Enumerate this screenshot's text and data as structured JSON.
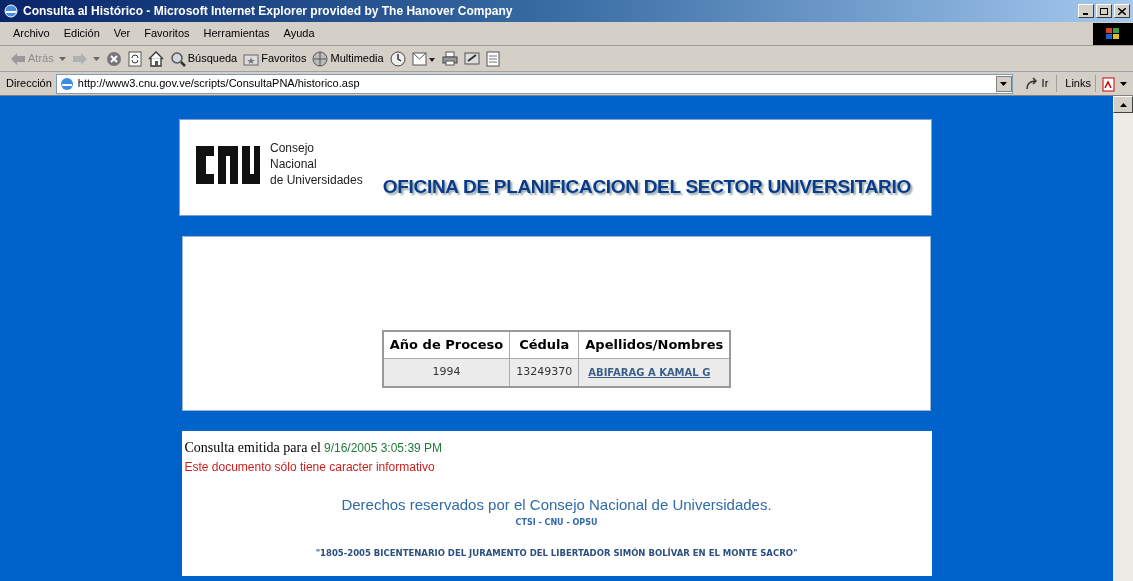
{
  "window": {
    "title": "Consulta al Histórico - Microsoft Internet Explorer provided by The Hanover Company"
  },
  "menu": [
    "Archivo",
    "Edición",
    "Ver",
    "Favoritos",
    "Herramientas",
    "Ayuda"
  ],
  "toolbar": [
    {
      "kind": "back",
      "label": "Atrás",
      "disabled": true
    },
    {
      "kind": "forward",
      "disabled": true
    },
    {
      "kind": "stop"
    },
    {
      "kind": "refresh"
    },
    {
      "kind": "home"
    },
    {
      "kind": "search",
      "label": "Búsqueda"
    },
    {
      "kind": "favorites",
      "label": "Favoritos"
    },
    {
      "kind": "media",
      "label": "Multimedia"
    },
    {
      "kind": "history"
    },
    {
      "kind": "mail"
    },
    {
      "kind": "print"
    },
    {
      "kind": "edit"
    },
    {
      "kind": "discuss"
    }
  ],
  "address": {
    "label": "Dirección",
    "url": "http://www3.cnu.gov.ve/scripts/ConsultaPNA/historico.asp",
    "go": "Ir",
    "links": "Links"
  },
  "header": {
    "logo_lines": [
      "Consejo",
      "Nacional",
      "de Universidades"
    ],
    "title": "OFICINA DE PLANIFICACION DEL SECTOR UNIVERSITARIO"
  },
  "table": {
    "columns": [
      "Año de Proceso",
      "Cédula",
      "Apellidos/Nombres"
    ],
    "rows": [
      [
        "1994",
        "13249370",
        "ABIFARAG A KAMAL G"
      ]
    ]
  },
  "footer": {
    "issued_label": "Consulta emitida para el",
    "issued_date": "9/16/2005 3:05:39 PM",
    "notice": "Este documento sólo tiene caracter informativo",
    "rights": "Derechos reservados por el Consejo Nacional de Universidades.",
    "orgs": "CTSI - CNU - OPSU",
    "motto": "\"1805-2005 BICENTENARIO DEL JURAMENTO DEL LIBERTADOR SIMÓN BOLÍVAR EN EL MONTE SACRO\""
  }
}
